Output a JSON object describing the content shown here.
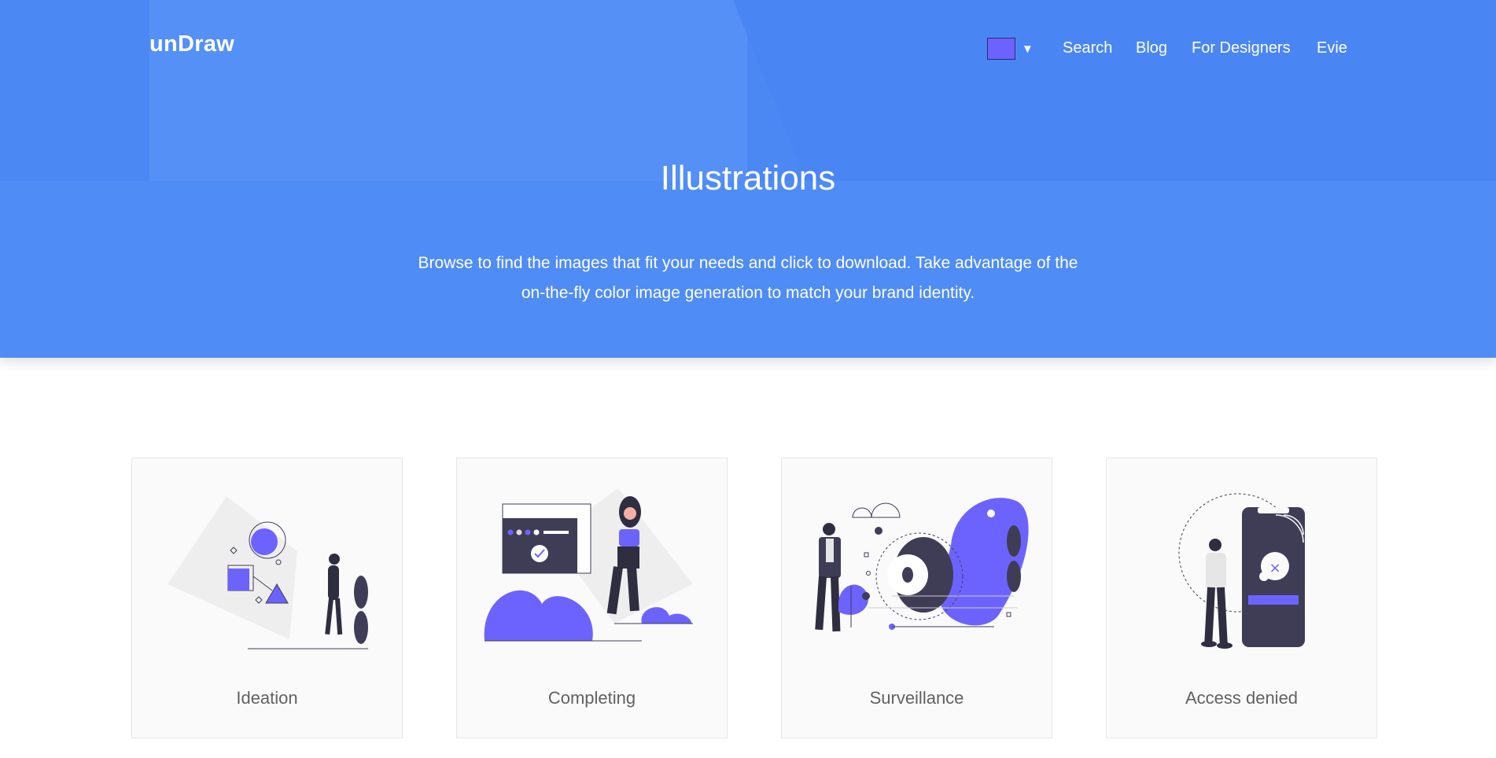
{
  "header": {
    "brand": "unDraw",
    "color_picker": {
      "color": "#6c63ff",
      "caret": "▼"
    },
    "nav": [
      {
        "label": "Search"
      },
      {
        "label": "Blog"
      },
      {
        "label": "For Designers"
      },
      {
        "label": "Evie"
      }
    ]
  },
  "hero": {
    "title": "Illustrations",
    "description": "Browse to find the images that fit your needs and click to download. Take advantage of the on-the-fly color image generation to match your brand identity."
  },
  "illustrations": [
    {
      "label": "Ideation",
      "icon": "ideation-illustration"
    },
    {
      "label": "Completing",
      "icon": "completing-illustration"
    },
    {
      "label": "Surveillance",
      "icon": "surveillance-illustration"
    },
    {
      "label": "Access denied",
      "icon": "access-denied-illustration"
    }
  ],
  "colors": {
    "hero_bg": "#4f8cf5",
    "accent": "#6c63ff",
    "dark": "#3f3d56",
    "card_bg": "#fafafa"
  }
}
